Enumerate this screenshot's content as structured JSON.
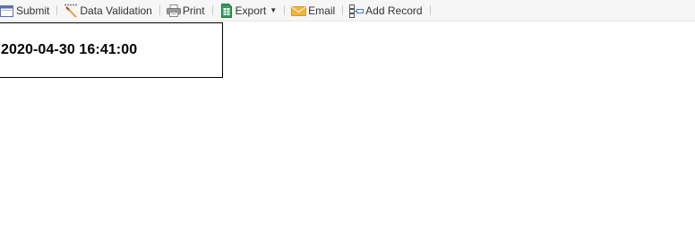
{
  "toolbar": {
    "submit_label": "Submit",
    "data_validation_label": "Data Validation",
    "print_label": "Print",
    "export_label": "Export",
    "email_label": "Email",
    "add_record_label": "Add Record",
    "icons": {
      "submit": "window-icon",
      "data_validation": "magic-wand-icon",
      "print": "printer-icon",
      "export": "spreadsheet-file-icon",
      "email": "envelope-icon",
      "add_record": "insert-row-icon"
    },
    "colors": {
      "background": "#f6f6f6",
      "text": "#333333",
      "submit_icon": "#5b6fb8",
      "export_icon": "#2e9e5b",
      "email_icon": "#f0b43c"
    }
  },
  "report": {
    "cell_value": "2020-04-30 16:41:00"
  }
}
